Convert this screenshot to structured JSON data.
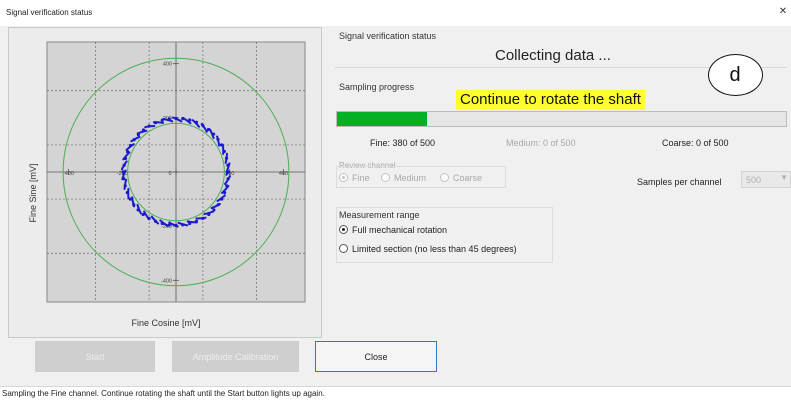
{
  "window": {
    "title": "Signal verification status",
    "close_glyph": "✕"
  },
  "plot": {
    "xlabel": "Fine Cosine [mV]",
    "ylabel": "Fine Sine [mV]",
    "x_ticks": [
      "-400",
      "-200",
      "0",
      "200",
      "400"
    ],
    "y_ticks": [
      "400",
      "200",
      "0",
      "-200",
      "-400"
    ],
    "colors": {
      "outer": "#4caf50",
      "inner": "#4caf50",
      "samples": "#1a1acc",
      "grid": "#6b6b6b"
    }
  },
  "chart_data": {
    "type": "scatter",
    "xlabel": "Fine Cosine [mV]",
    "ylabel": "Fine Sine [mV]",
    "xlim": [
      -480,
      480
    ],
    "ylim": [
      -480,
      480
    ],
    "grid": true,
    "series": [
      {
        "type": "circle",
        "radius": 420
      },
      {
        "type": "circle",
        "radius": 180
      },
      {
        "type": "scatter",
        "points": [
          [
            195,
            0
          ],
          [
            193,
            25
          ],
          [
            188,
            51
          ],
          [
            180,
            76
          ],
          [
            169,
            100
          ],
          [
            156,
            121
          ],
          [
            140,
            140
          ],
          [
            121,
            157
          ],
          [
            100,
            172
          ],
          [
            76,
            184
          ],
          [
            51,
            192
          ],
          [
            25,
            197
          ],
          [
            0,
            198
          ],
          [
            -25,
            196
          ],
          [
            -51,
            191
          ],
          [
            -76,
            182
          ],
          [
            -100,
            170
          ],
          [
            -121,
            155
          ],
          [
            -140,
            138
          ],
          [
            -156,
            119
          ],
          [
            -169,
            98
          ],
          [
            -180,
            75
          ],
          [
            -188,
            50
          ],
          [
            -193,
            25
          ],
          [
            -196,
            0
          ],
          [
            -194,
            -25
          ],
          [
            -189,
            -51
          ],
          [
            -181,
            -76
          ],
          [
            -170,
            -100
          ],
          [
            -157,
            -121
          ],
          [
            -141,
            -140
          ],
          [
            -122,
            -157
          ],
          [
            -100,
            -171
          ],
          [
            -76,
            -182
          ],
          [
            -51,
            -190
          ],
          [
            -25,
            -195
          ],
          [
            0,
            -197
          ],
          [
            25,
            -195
          ],
          [
            51,
            -190
          ],
          [
            76,
            -182
          ],
          [
            100,
            -171
          ],
          [
            122,
            -157
          ],
          [
            141,
            -140
          ],
          [
            157,
            -121
          ],
          [
            170,
            -100
          ],
          [
            181,
            -76
          ],
          [
            189,
            -51
          ],
          [
            194,
            -25
          ]
        ]
      }
    ]
  },
  "status": {
    "group_label": "Signal verification status",
    "text": "Collecting data ..."
  },
  "annotation": {
    "letter": "d"
  },
  "sampling": {
    "group_label": "Sampling progress",
    "hint": "Continue to rotate the shaft",
    "progress": 0.2,
    "fine": "Fine: 380 of 500",
    "medium": "Medium: 0 of 500",
    "coarse": "Coarse: 0 of 500"
  },
  "review": {
    "label": "Review channel",
    "options": [
      "Fine",
      "Medium",
      "Coarse"
    ],
    "selected": "Fine"
  },
  "samples_per_channel": {
    "label": "Samples per channel",
    "value": "500"
  },
  "measurement_range": {
    "label": "Measurement range",
    "options": [
      "Full mechanical rotation",
      "Limited section (no less than 45 degrees)"
    ],
    "selected": "Full mechanical rotation"
  },
  "buttons": {
    "start": "Start",
    "amplitude": "Amplitude Calibration",
    "close": "Close"
  },
  "statusbar": {
    "text": "Sampling the Fine channel. Continue rotating the shaft until the Start button lights up again."
  }
}
